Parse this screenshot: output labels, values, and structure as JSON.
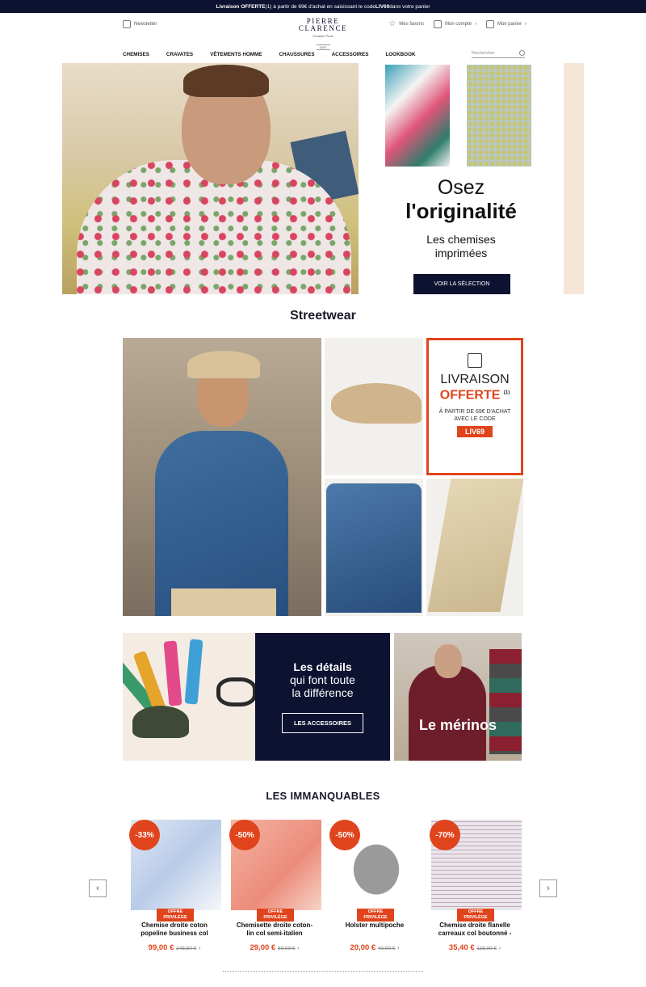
{
  "topbar": {
    "bold": "Livraison OFFERTE",
    "text": "(1) à partir de 69€ d'achat en saisissant le code ",
    "code": "LIV69",
    "tail": " dans votre panier"
  },
  "header": {
    "newsletter": "Newsletter",
    "logo_line1": "PIERRE",
    "logo_line2": "CLARENCE",
    "logo_line3": "Création Paris",
    "logo_line4": "1947",
    "favorites": "Mes favoris",
    "account": "Mon compte",
    "cart": "Mon panier"
  },
  "nav": {
    "items": [
      "CHEMISES",
      "CRAVATES",
      "VÊTEMENTS HOMME",
      "CHAUSSURES",
      "ACCESSOIRES",
      "LOOKBOOK"
    ],
    "search_placeholder": "Rechercher"
  },
  "hero": {
    "title1": "Osez",
    "title2": "l'originalité",
    "subtitle1": "Les chemises",
    "subtitle2": "imprimées",
    "button": "VOIR LA SÉLECTION"
  },
  "streetwear": {
    "heading": "Streetwear",
    "promo_line1": "LIVRAISON",
    "promo_line2": "OFFERTE",
    "promo_sup": "(1)",
    "promo_line3": "À PARTIR DE 69€ D'ACHAT",
    "promo_line4": "AVEC LE CODE",
    "promo_code": "LIV69"
  },
  "accessories": {
    "line1": "Les détails",
    "line2": "qui font toute",
    "line3": "la différence",
    "button": "LES ACCESSOIRES",
    "merinos": "Le mérinos"
  },
  "immanquables": {
    "heading": "LES IMMANQUABLES",
    "prev": "‹",
    "next": "›",
    "products": [
      {
        "discount": "-33%",
        "offer1": "OFFRE",
        "offer2": "PRIVILÈGE",
        "name1": "Chemise droite coton",
        "name2": "popeline business col",
        "price": "99,00 €",
        "old": "148,50 €",
        "chev": "›"
      },
      {
        "discount": "-50%",
        "offer1": "OFFRE",
        "offer2": "PRIVILÈGE",
        "name1": "Chemisette droite coton-",
        "name2": "lin col semi-italien",
        "price": "29,00 €",
        "old": "69,00 €",
        "chev": "›"
      },
      {
        "discount": "-50%",
        "offer1": "OFFRE",
        "offer2": "PRIVILÈGE",
        "name1": "Holster multipoche",
        "name2": "",
        "price": "20,00 €",
        "old": "40,00 €",
        "chev": "›"
      },
      {
        "discount": "-70%",
        "offer1": "OFFRE",
        "offer2": "PRIVILÈGE",
        "name1": "Chemise droite flanelle",
        "name2": "carreaux col boutonné -",
        "price": "35,40 €",
        "old": "118,00 €",
        "chev": "›"
      }
    ]
  }
}
